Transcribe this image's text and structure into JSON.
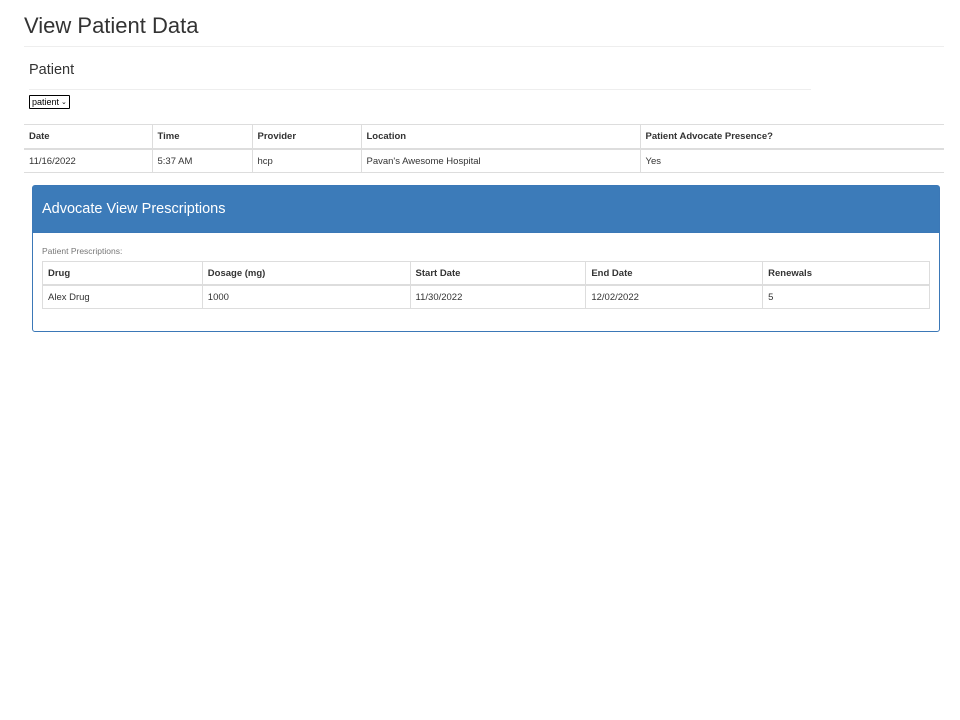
{
  "page": {
    "title": "View Patient Data"
  },
  "patient_section": {
    "title": "Patient",
    "select_value": "patient"
  },
  "visits": {
    "headers": [
      "Date",
      "Time",
      "Provider",
      "Location",
      "Patient Advocate Presence?"
    ],
    "rows": [
      [
        "11/16/2022",
        "5:37 AM",
        "hcp",
        "Pavan's Awesome Hospital",
        "Yes"
      ]
    ]
  },
  "prescriptions_panel": {
    "title": "Advocate View Prescriptions",
    "caption": "Patient Prescriptions:",
    "headers": [
      "Drug",
      "Dosage (mg)",
      "Start Date",
      "End Date",
      "Renewals"
    ],
    "rows": [
      [
        "Alex Drug",
        "1000",
        "11/30/2022",
        "12/02/2022",
        "5"
      ]
    ]
  },
  "colors": {
    "panel_heading": "#3c7bb9",
    "panel_border": "#3b78b7",
    "table_border": "#dddddd"
  },
  "icons": {
    "select_chevron": "chevron-down-icon"
  }
}
